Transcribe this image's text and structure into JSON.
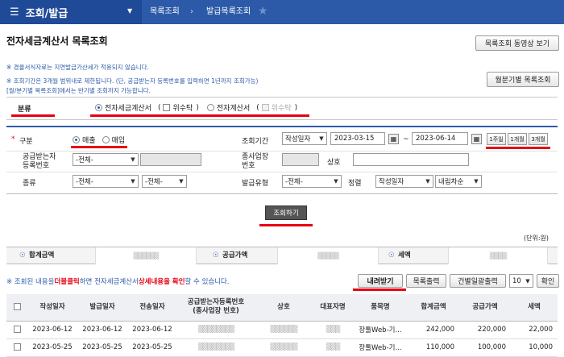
{
  "topbar": {
    "menu_icon": "hamburger-icon",
    "menu_label": "조회/발급",
    "crumbs": [
      "목록조회",
      "발급목록조회"
    ]
  },
  "page": {
    "title": "전자세금계산서 목록조회",
    "video_button": "목록조회 동영상 보기",
    "quarter_button": "월분기별 목록조회",
    "notes": [
      "※ 경율서식자료는 지연발급가산세가 적용되지 않습니다.",
      "※ 조회기간은 3개월 범위내로 제한됩니다. (단, 공급받는자 등록번호를 입력하면 1년까지 조회가능)",
      "[월/분기별 목록조회]에서는 반기별 조회까지 가능합니다."
    ]
  },
  "category": {
    "label": "분류",
    "opt1": "전자세금계산서",
    "opt1_chk": "위수탁",
    "opt2": "전자계산서",
    "opt2_chk": "위수탁"
  },
  "form": {
    "gubun_label": "구분",
    "gubun_opt1": "매출",
    "gubun_opt2": "매입",
    "period_label": "조회기간",
    "period_type": "작성일자",
    "date_from": "2023-03-15",
    "tilde": "~",
    "date_to": "2023-06-14",
    "period_btns": [
      "1주일",
      "1개월",
      "3개월"
    ],
    "receiver_label_1": "공급받는자",
    "receiver_label_2": "등록번호",
    "receiver_select": "-전체-",
    "branch_label_1": "종사업장",
    "branch_label_2": "번호",
    "company_label": "상호",
    "type_label": "종류",
    "type_select1": "-전체-",
    "type_select2": "-전체-",
    "issue_label": "발급유형",
    "issue_select": "-전체-",
    "sort_label": "정렬",
    "sort_select1": "작성일자",
    "sort_select2": "내림차순",
    "search_button": "조회하기"
  },
  "summary": {
    "unit": "(단위:원)",
    "total_label": "합계금액",
    "supply_label": "공급가액",
    "tax_label": "세액"
  },
  "toolbar": {
    "note_pre": "※ 조회된 내용을 ",
    "note_em1": "더블클릭",
    "note_mid": " 하면 전자세금계산서 ",
    "note_em2": "상세내용을 확인",
    "note_post": " 할 수 있습니다.",
    "download": "내려받기",
    "print_list": "목록출력",
    "print_each": "건별일괄출력",
    "page_size": "10",
    "confirm": "확인"
  },
  "table": {
    "headers": [
      "",
      "작성일자",
      "발급일자",
      "전송일자",
      "공급받는자등록번호\n(종사업장 번호)",
      "상호",
      "대표자명",
      "품목명",
      "합계금액",
      "공급가액",
      "세액"
    ],
    "rows": [
      [
        "",
        "2023-06-12",
        "2023-06-12",
        "2023-06-12",
        "",
        "",
        "",
        "장툴Web-기...",
        "242,000",
        "220,000",
        "22,000"
      ],
      [
        "",
        "2023-05-25",
        "2023-05-25",
        "2023-05-25",
        "",
        "",
        "",
        "장툴Web-기...",
        "110,000",
        "100,000",
        "10,000"
      ]
    ]
  }
}
